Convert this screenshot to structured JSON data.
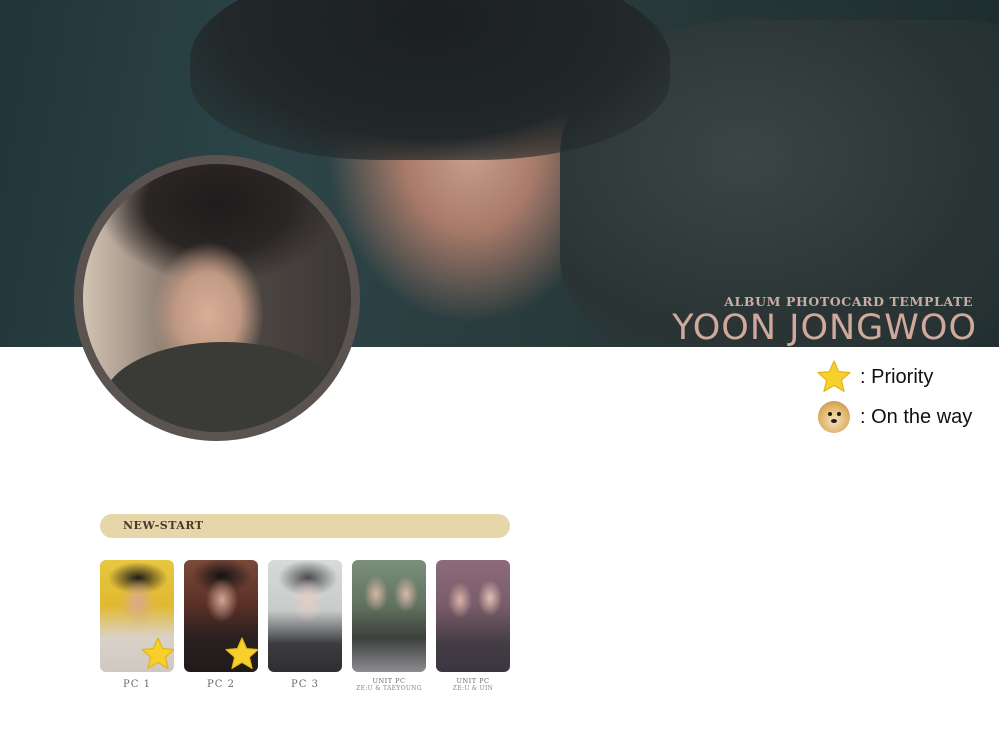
{
  "banner": {
    "subtitle": "ALBUM PHOTOCARD TEMPLATE",
    "title": "YOON JONGWOO"
  },
  "legend": [
    {
      "icon": "star-icon",
      "label": ": Priority"
    },
    {
      "icon": "doge-icon",
      "label": ": On the way"
    }
  ],
  "section": {
    "title": "NEW-START"
  },
  "cards": [
    {
      "label": "PC 1",
      "sublabel": "",
      "priority": true
    },
    {
      "label": "PC 2",
      "sublabel": "",
      "priority": true
    },
    {
      "label": "PC 3",
      "sublabel": "",
      "priority": false
    },
    {
      "label": "UNIT PC",
      "sublabel": "ZE:U & TAEYOUNG",
      "priority": false
    },
    {
      "label": "UNIT PC",
      "sublabel": "ZE:U & UIN",
      "priority": false
    }
  ],
  "colors": {
    "star": "#f7d12b",
    "section_bar": "#e8d6ab",
    "title_text": "#d0a99c",
    "avatar_ring": "#5a5350"
  }
}
